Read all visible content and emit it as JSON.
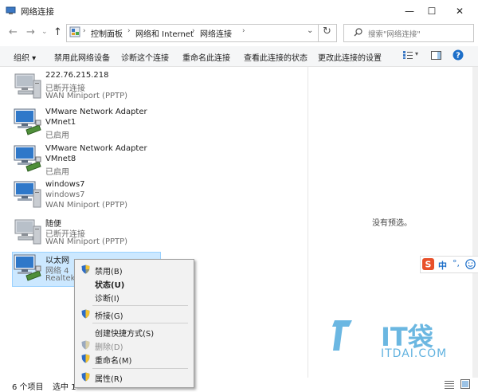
{
  "window": {
    "title": "网络连接",
    "controls": {
      "minimize": "—",
      "maximize": "☐",
      "close": "✕"
    }
  },
  "address": {
    "crumbs": [
      "控制面板",
      "网络和 Internet",
      "网络连接"
    ],
    "search_placeholder": "搜索\"网络连接\""
  },
  "commands": [
    "组织 ▾",
    "禁用此网络设备",
    "诊断这个连接",
    "重命名此连接",
    "查看此连接的状态",
    "更改此连接的设置"
  ],
  "connections": [
    {
      "name": "222.76.215.218",
      "line2": "已断开连接",
      "line3": "WAN Miniport (PPTP)"
    },
    {
      "name": "VMware Network Adapter",
      "line2": "VMnet1",
      "line3": "已启用"
    },
    {
      "name": "VMware Network Adapter",
      "line2": "VMnet8",
      "line3": "已启用"
    },
    {
      "name": "windows7",
      "line2": "windows7",
      "line3": "WAN Miniport (PPTP)"
    },
    {
      "name": "随便",
      "line2": "已断开连接",
      "line3": "WAN Miniport (PPTP)"
    },
    {
      "name": "以太网",
      "line2": "网络 4",
      "line3": "Realtek I"
    }
  ],
  "preview_text": "没有预选。",
  "status": {
    "count": "6 个项目",
    "selected": "选中 1"
  },
  "context_menu": [
    {
      "label": "禁用(B)",
      "shield": true,
      "style": "normal"
    },
    {
      "label": "状态(U)",
      "shield": false,
      "style": "bold"
    },
    {
      "label": "诊断(I)",
      "shield": false,
      "style": "normal"
    },
    {
      "label": "桥接(G)",
      "shield": true,
      "style": "normal"
    },
    {
      "label": "创建快捷方式(S)",
      "shield": false,
      "style": "normal"
    },
    {
      "label": "删除(D)",
      "shield": true,
      "style": "disabled"
    },
    {
      "label": "重命名(M)",
      "shield": true,
      "style": "normal"
    },
    {
      "label": "属性(R)",
      "shield": true,
      "style": "normal"
    }
  ],
  "ime": {
    "lang": "中",
    "punct": "°,"
  },
  "watermark": {
    "brand": "IT袋",
    "site": "ITDAI.COM"
  },
  "colors": {
    "accent": "#0078d7",
    "selection": "#cce8ff",
    "watermark": "#3a9fd8"
  }
}
